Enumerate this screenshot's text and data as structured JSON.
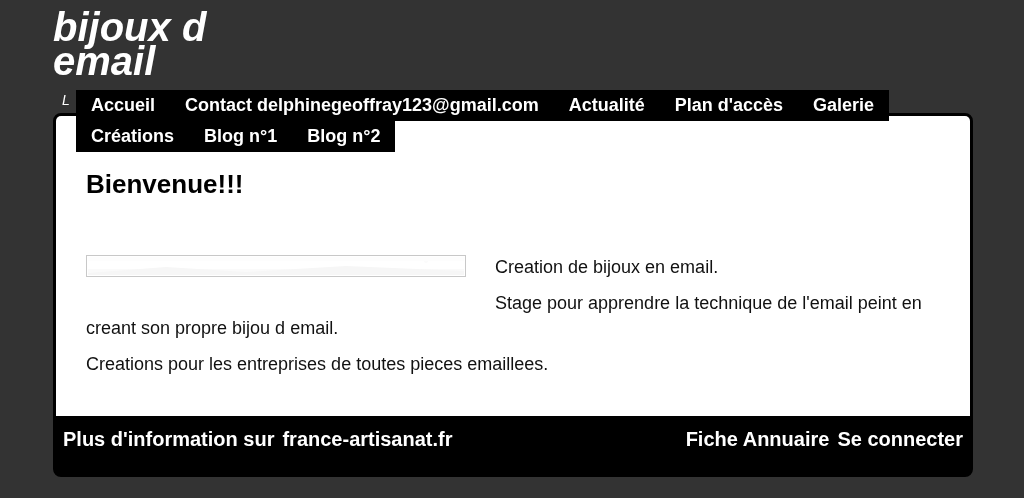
{
  "site_title": "bijoux d email",
  "tagline": "L",
  "nav": [
    {
      "label": "Accueil",
      "selected": false
    },
    {
      "label": "Contact delphinegeoffray123@gmail.com",
      "selected": false
    },
    {
      "label": "Actualité",
      "selected": false
    },
    {
      "label": "Plan d'accès",
      "selected": false
    },
    {
      "label": "Galerie",
      "selected": false
    },
    {
      "label": "Créations",
      "selected": false
    },
    {
      "label": "Blog n°1",
      "selected": false
    },
    {
      "label": "Blog n°2",
      "selected": false
    }
  ],
  "heading": "Bienvenue!!!",
  "paragraphs": [
    "Creation de bijoux en email.",
    "Stage pour apprendre la technique  de l'email peint en creant son propre bijou d email.",
    "Creations pour les entreprises de toutes pieces emaillees."
  ],
  "footer": {
    "text": "Plus d'information sur",
    "link": "france-artisanat.fr",
    "links": [
      "Fiche Annuaire",
      "Se connecter"
    ]
  }
}
